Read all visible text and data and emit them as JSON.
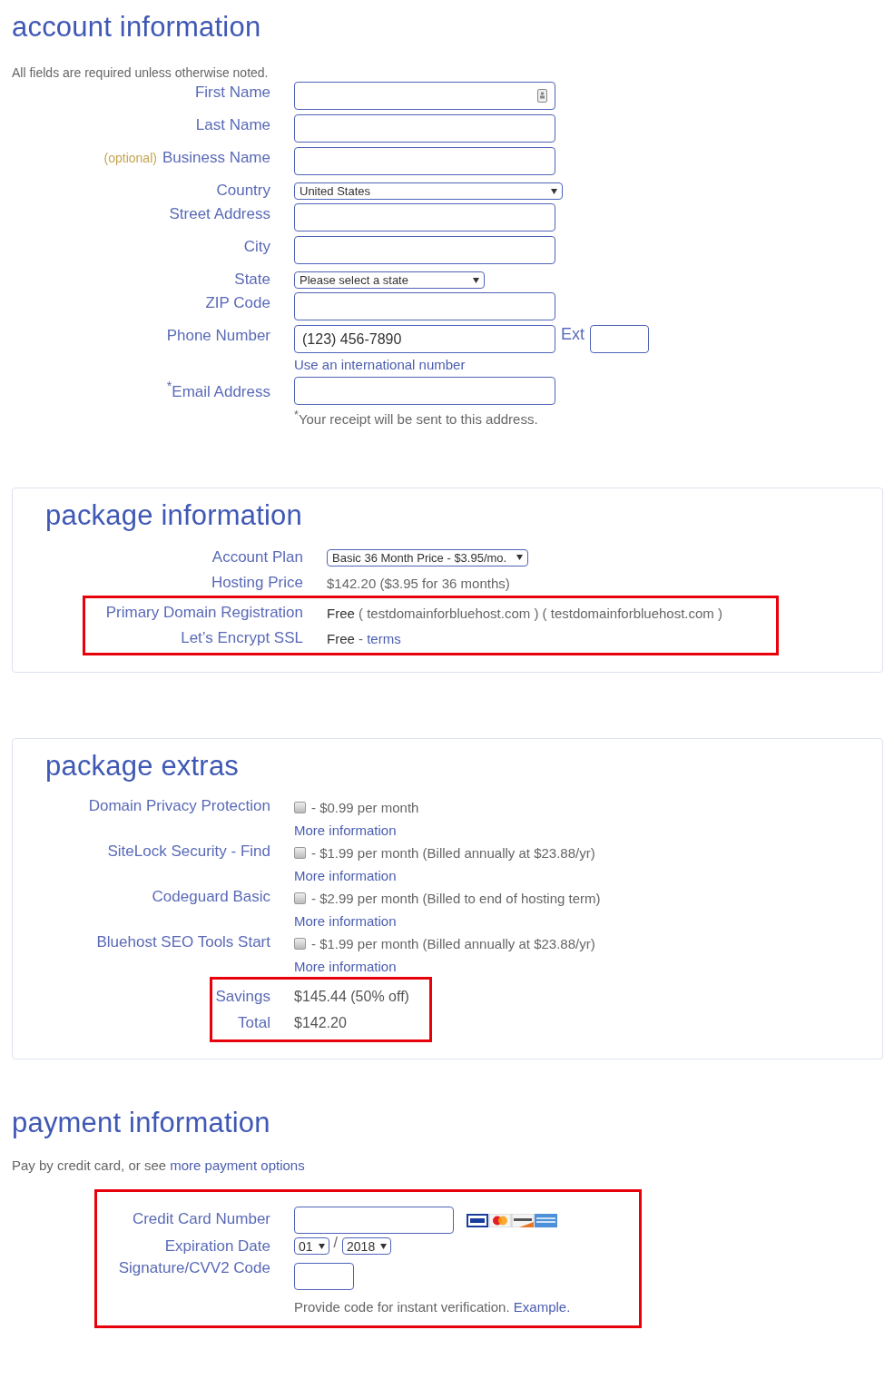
{
  "account": {
    "title": "account information",
    "note": "All fields are required unless otherwise noted.",
    "fields": [
      {
        "kind": "text",
        "label": "First Name",
        "contact_icon": true
      },
      {
        "kind": "text",
        "label": "Last Name"
      },
      {
        "kind": "text",
        "label": "Business Name",
        "prefix": "(optional)"
      },
      {
        "kind": "select",
        "label": "Country",
        "value": "United States"
      },
      {
        "kind": "text",
        "label": "Street Address"
      },
      {
        "kind": "text",
        "label": "City"
      },
      {
        "kind": "select",
        "label": "State",
        "value": "Please select a state"
      },
      {
        "kind": "text",
        "label": "ZIP Code"
      },
      {
        "kind": "phone",
        "label": "Phone Number",
        "value": "(123) 456-7890",
        "ext_label": "Ext",
        "hint": "Use an international number"
      },
      {
        "kind": "text",
        "label": "$^{*}$Email Address",
        "hint": "$^{*}$Your receipt will be sent to this address."
      }
    ]
  },
  "package": {
    "title": "package information",
    "rows": [
      {
        "kind": "select",
        "label": "Account Plan",
        "value": "Basic 36 Month Price - $3.95/mo.",
        "highlighted": false
      },
      {
        "kind": "text",
        "label": "Hosting Price",
        "value": "$142.20  ($3.95 for 36 months)",
        "highlighted": false
      },
      {
        "kind": "text",
        "label": "Primary Domain Registration",
        "value": "**Free** ( testdomainforbluehost.com ) ( testdomainforbluehost.com )",
        "highlighted": true
      },
      {
        "kind": "link",
        "label": "Let’s Encrypt SSL",
        "value": "**Free** - ",
        "link": "terms",
        "highlighted": true
      }
    ]
  },
  "extras": {
    "title": "package extras",
    "items": [
      {
        "label": "Domain Privacy Protection",
        "checked": false,
        "price": "- $0.99 per month",
        "link": "More information"
      },
      {
        "label": "SiteLock Security - Find",
        "checked": false,
        "price": "- $1.99 per month (Billed annually at $23.88/yr)",
        "link": "More information"
      },
      {
        "label": "Codeguard Basic",
        "checked": false,
        "price": "- $2.99 per month (Billed to end of hosting term)",
        "link": "More information"
      },
      {
        "label": "Bluehost SEO Tools Start",
        "checked": false,
        "price": "- $1.99 per month (Billed annually at $23.88/yr)",
        "link": "More information"
      }
    ],
    "totals": {
      "highlighted": true,
      "rows": [
        {
          "label": "Savings",
          "value": "$145.44 (50% off)"
        },
        {
          "label": "Total",
          "value": "$142.20"
        }
      ]
    }
  },
  "payment": {
    "title": "payment information",
    "intro": "Pay by credit card, or see",
    "intro_link": "more payment options",
    "form": {
      "highlighted": true,
      "card_label": "Credit Card Number",
      "expiry_label": "Expiration Date",
      "month": "01",
      "separator": "/",
      "year": "2018",
      "cvv_label": "Signature/CVV2 Code",
      "hint": "Provide code for instant verification.",
      "hint_link": "Example."
    }
  }
}
